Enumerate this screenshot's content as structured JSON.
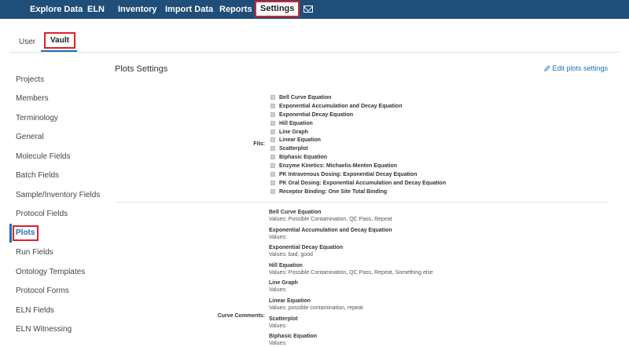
{
  "nav": {
    "items": [
      "Explore Data",
      "ELN",
      "Inventory",
      "Import Data",
      "Reports",
      "Settings"
    ],
    "active": "Settings",
    "mail_icon": "mail-icon"
  },
  "subtabs": {
    "user": "User",
    "vault": "Vault",
    "active": "Vault"
  },
  "sidebar": {
    "items": [
      "Projects",
      "Members",
      "Terminology",
      "General",
      "Molecule Fields",
      "Batch Fields",
      "Sample/Inventory Fields",
      "Protocol Fields",
      "Plots",
      "Run Fields",
      "Ontology Templates",
      "Protocol Forms",
      "ELN Fields",
      "ELN Witnessing"
    ],
    "active": "Plots"
  },
  "main": {
    "title": "Plots Settings",
    "edit_link": "Edit plots settings",
    "fits_label": "Fits:",
    "fits": [
      "Bell Curve Equation",
      "Exponential Accumulation and Decay Equation",
      "Exponential Decay Equation",
      "Hill Equation",
      "Line Graph",
      "Linear Equation",
      "Scatterplot",
      "Biphasic Equation",
      "Enzyme Kinetics: Michaelis-Menten Equation",
      "PK Intravenous Dosing: Exponential Decay Equation",
      "PK Oral Dosing: Exponential Accumulation and Decay Equation",
      "Receptor Binding: One Site Total Binding"
    ],
    "curve_comments_label": "Curve Comments:",
    "curve_comments": [
      {
        "name": "Bell Curve Equation",
        "values": "Values: Possible Contamination, QC Pass, Repeat"
      },
      {
        "name": "Exponential Accumulation and Decay Equation",
        "values": "Values:"
      },
      {
        "name": "Exponential Decay Equation",
        "values": "Values: bad, good"
      },
      {
        "name": "Hill Equation",
        "values": "Values: Possible Contamination, QC Pass, Repeat, Something else"
      },
      {
        "name": "Line Graph",
        "values": "Values:"
      },
      {
        "name": "Linear Equation",
        "values": "Values: possible contamination, repeat"
      },
      {
        "name": "Scatterplot",
        "values": "Values:"
      },
      {
        "name": "Biphasic Equation",
        "values": "Values:"
      }
    ]
  },
  "colors": {
    "nav_bg": "#1f4e79",
    "accent_blue": "#1c6fb6",
    "highlight_red": "#d9232d"
  }
}
